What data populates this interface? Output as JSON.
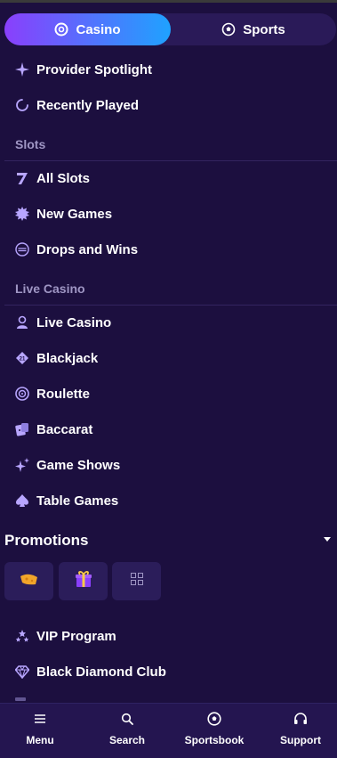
{
  "toggle": {
    "casino_label": "Casino",
    "sports_label": "Sports"
  },
  "menu": {
    "provider_spotlight": "Provider Spotlight",
    "recently_played": "Recently Played",
    "slots_header": "Slots",
    "all_slots": "All Slots",
    "new_games": "New Games",
    "drops_and_wins": "Drops and Wins",
    "live_casino_header": "Live Casino",
    "live_casino": "Live Casino",
    "blackjack": "Blackjack",
    "roulette": "Roulette",
    "baccarat": "Baccarat",
    "game_shows": "Game Shows",
    "table_games": "Table Games"
  },
  "promotions": {
    "title": "Promotions"
  },
  "vip": {
    "vip_program": "VIP Program",
    "black_diamond_club": "Black Diamond Club"
  },
  "bottom_nav": {
    "menu": "Menu",
    "search": "Search",
    "sportsbook": "Sportsbook",
    "support": "Support"
  },
  "colors": {
    "background": "#1c0f3f",
    "accent_purple": "#8a3ffc",
    "accent_blue": "#1fa2ff",
    "icon_lavender": "#b8a6ff"
  },
  "icons": [
    "casino-chip-icon",
    "soccer-ball-icon",
    "sparkle-icon",
    "loading-arc-icon",
    "seven-icon",
    "starburst-icon",
    "drops-wins-icon",
    "dealer-icon",
    "blackjack-icon",
    "roulette-icon",
    "dice-cards-icon",
    "sparkles-icon",
    "spade-icon",
    "cheese-icon",
    "gift-icon",
    "grid-icon",
    "stars-icon",
    "diamond-icon",
    "hamburger-icon",
    "search-icon",
    "headset-icon"
  ]
}
